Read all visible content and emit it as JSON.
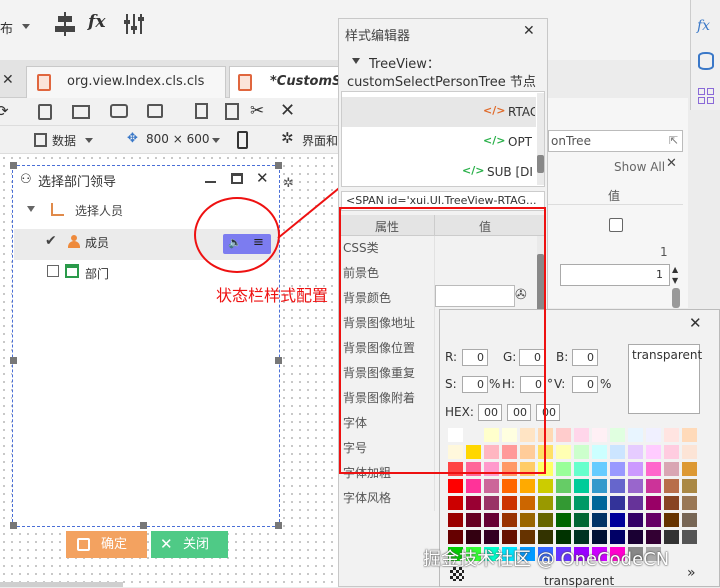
{
  "toolbar_top": {
    "label_partial": "布",
    "fx": "fx"
  },
  "tabs": [
    {
      "label": "org.view.Index.cls.cls"
    },
    {
      "label": "*CustomS"
    }
  ],
  "toolbar2": {
    "data_label": "数据",
    "size_label": "800 × 600",
    "style_label": "界面和"
  },
  "dialog": {
    "title": "选择部门领导",
    "tree": {
      "root": "选择人员",
      "member": "成员",
      "dept": "部门"
    },
    "ok": "确定",
    "close": "关闭"
  },
  "annotation": "状态栏样式配置",
  "style_editor": {
    "title": "样式编辑器",
    "node_line1": "TreeView：",
    "node_line2": "customSelectPersonTree 节点",
    "tags": [
      "RTAG",
      "OPT",
      "SUB [DI"
    ],
    "html_snippet": "<SPAN id='xui.UI.TreeView-RTAG...",
    "col_prop": "属性",
    "col_val": "值",
    "properties": [
      "CSS类",
      "前景色",
      "背景颜色",
      "背景图像地址",
      "背景图像位置",
      "背景图像重复",
      "背景图像附着",
      "字体",
      "字号",
      "字体加粗",
      "字体风格"
    ]
  },
  "right_panel": {
    "search_text": "onTree",
    "show_all": "Show All",
    "col_val": "值",
    "row_value": "1",
    "stepper_value": "1"
  },
  "color_picker": {
    "r": "0",
    "g": "0",
    "b": "0",
    "s": "0",
    "h": "0",
    "v": "0",
    "hex": [
      "00",
      "00",
      "00"
    ],
    "preview_label": "transparent",
    "bottom_label": "transparent",
    "labels": {
      "r": "R:",
      "g": "G:",
      "b": "B:",
      "s": "S:",
      "h": "H:",
      "v": "V:",
      "hex": "HEX:",
      "pct": "%"
    }
  },
  "watermark": "掘金技术社区 @ OneCodeCN",
  "palette": [
    "#ffffff",
    "#f2f2f2",
    "#ffffcc",
    "#ffffe0",
    "#ffe4c4",
    "#ffd9b3",
    "#ffcccc",
    "#ffd6ea",
    "#fff0f5",
    "#e0ffe0",
    "#e8f5ff",
    "#f0f0ff",
    "#ffe4e1",
    "#ffdab9",
    "#fff8dc",
    "#ffd700",
    "#ffb6c1",
    "#ff9999",
    "#ffcc99",
    "#ffe066",
    "#ffffb3",
    "#ccffcc",
    "#ccffff",
    "#cce5ff",
    "#e6ccff",
    "#ffccff",
    "#ffcce0",
    "#fce4d6",
    "#ff4444",
    "#ff6699",
    "#ff99cc",
    "#ff9966",
    "#ffcc66",
    "#ffff66",
    "#99ff99",
    "#66ffcc",
    "#66ccff",
    "#9999ff",
    "#cc99ff",
    "#ff66cc",
    "#d9a6b3",
    "#dd9933",
    "#ff0000",
    "#ff3399",
    "#cc6699",
    "#ff6600",
    "#ffaa00",
    "#cccc00",
    "#66cc66",
    "#00cc99",
    "#3399cc",
    "#6666cc",
    "#9966cc",
    "#cc3399",
    "#b86e4a",
    "#aa8844",
    "#cc0000",
    "#990033",
    "#993366",
    "#cc3300",
    "#cc6600",
    "#999900",
    "#339933",
    "#009966",
    "#006699",
    "#333399",
    "#663399",
    "#990066",
    "#884422",
    "#997755",
    "#990000",
    "#660022",
    "#660033",
    "#993300",
    "#996600",
    "#666600",
    "#006600",
    "#006633",
    "#003366",
    "#000099",
    "#330066",
    "#660066",
    "#663300",
    "#776655",
    "#660000",
    "#330011",
    "#330022",
    "#661100",
    "#663300",
    "#333300",
    "#003300",
    "#003322",
    "#001133",
    "#000066",
    "#1a0033",
    "#330033",
    "#333333",
    "#555555",
    "#00cc00",
    "#33ff33",
    "#00ffcc",
    "#00e5ff",
    "#0099ff",
    "#3366ff",
    "#6633ff",
    "#9900ff",
    "#cc00ff",
    "#ff00cc",
    "#888888",
    "#aaaaaa"
  ]
}
